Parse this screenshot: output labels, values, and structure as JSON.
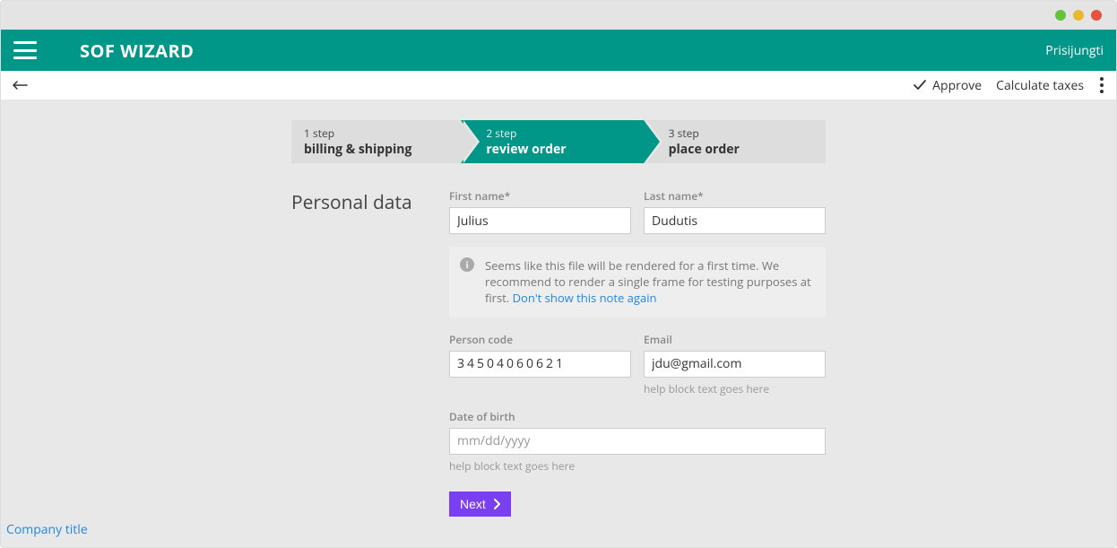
{
  "header": {
    "title": "SOF WIZARD",
    "login": "Prisijungti"
  },
  "toolbar": {
    "approve": "Approve",
    "calculate": "Calculate taxes"
  },
  "steps": [
    {
      "small": "1 step",
      "big": "billing & shipping"
    },
    {
      "small": "2 step",
      "big": "review order"
    },
    {
      "small": "3 step",
      "big": "place order"
    }
  ],
  "section": {
    "title": "Personal data"
  },
  "fields": {
    "first_name": {
      "label": "First name*",
      "value": "Julius"
    },
    "last_name": {
      "label": "Last name*",
      "value": "Dudutis"
    },
    "person_code": {
      "label": "Person code",
      "value": "34504060621"
    },
    "email": {
      "label": "Email",
      "value": "jdu@gmail.com",
      "help": "help block text goes here"
    },
    "dob": {
      "label": "Date of birth",
      "placeholder": "mm/dd/yyyy",
      "help": "help block text goes here"
    }
  },
  "note": {
    "text": "Seems like this file will be rendered for a first time. We recommend to render a single frame for testing purposes at first. ",
    "link": "Don't show this note again"
  },
  "buttons": {
    "next": "Next"
  },
  "footer": {
    "company": "Company title"
  }
}
